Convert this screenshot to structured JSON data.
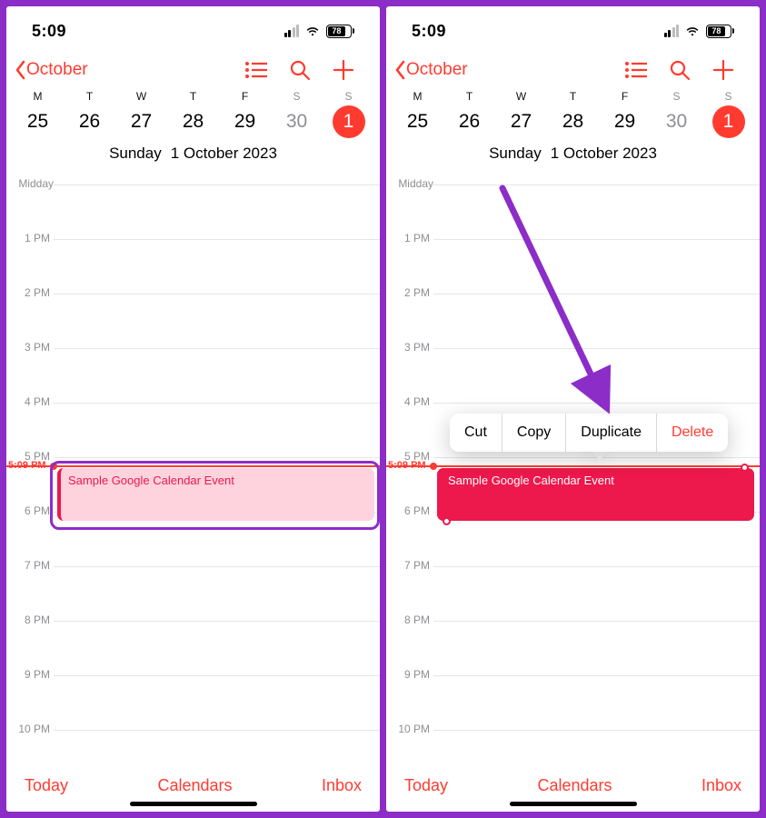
{
  "status": {
    "time": "5:09",
    "battery": "78"
  },
  "header": {
    "back_label": "October"
  },
  "weekdays": [
    "M",
    "T",
    "W",
    "T",
    "F",
    "S",
    "S"
  ],
  "dates": [
    "25",
    "26",
    "27",
    "28",
    "29",
    "30",
    "1"
  ],
  "full_date": {
    "dow": "Sunday",
    "rest": "1 October 2023"
  },
  "hours": [
    "Midday",
    "1 PM",
    "2 PM",
    "3 PM",
    "4 PM",
    "5 PM",
    "6 PM",
    "7 PM",
    "8 PM",
    "9 PM",
    "10 PM"
  ],
  "now_label": "5:09 PM",
  "event": {
    "title": "Sample Google Calendar Event"
  },
  "menu": {
    "cut": "Cut",
    "copy": "Copy",
    "duplicate": "Duplicate",
    "delete": "Delete"
  },
  "toolbar": {
    "today": "Today",
    "calendars": "Calendars",
    "inbox": "Inbox"
  }
}
